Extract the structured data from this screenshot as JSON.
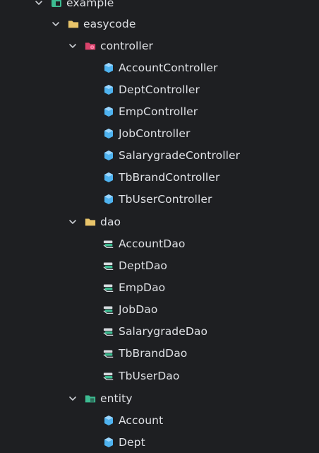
{
  "tree": {
    "root_label": "example",
    "package_easycode": "easycode",
    "package_controller": "controller",
    "controllers": [
      "AccountController",
      "DeptController",
      "EmpController",
      "JobController",
      "SalarygradeController",
      "TbBrandController",
      "TbUserController"
    ],
    "package_dao": "dao",
    "daos": [
      "AccountDao",
      "DeptDao",
      "EmpDao",
      "JobDao",
      "SalarygradeDao",
      "TbBrandDao",
      "TbUserDao"
    ],
    "package_entity": "entity",
    "entities": [
      "Account",
      "Dept"
    ]
  },
  "colors": {
    "background": "#1e1f22",
    "text": "#dfe1e5",
    "folder": "#e8c46a",
    "class_icon": "#4fb3f0",
    "controller_badge": "#d9436b",
    "entity_folder": "#3dbb91"
  },
  "icons": {
    "chevron": "chevron-down-icon",
    "folder": "folder-icon",
    "controller_folder": "controller-folder-icon",
    "entity_folder": "entity-folder-icon",
    "class": "class-icon",
    "interface": "interface-icon"
  }
}
